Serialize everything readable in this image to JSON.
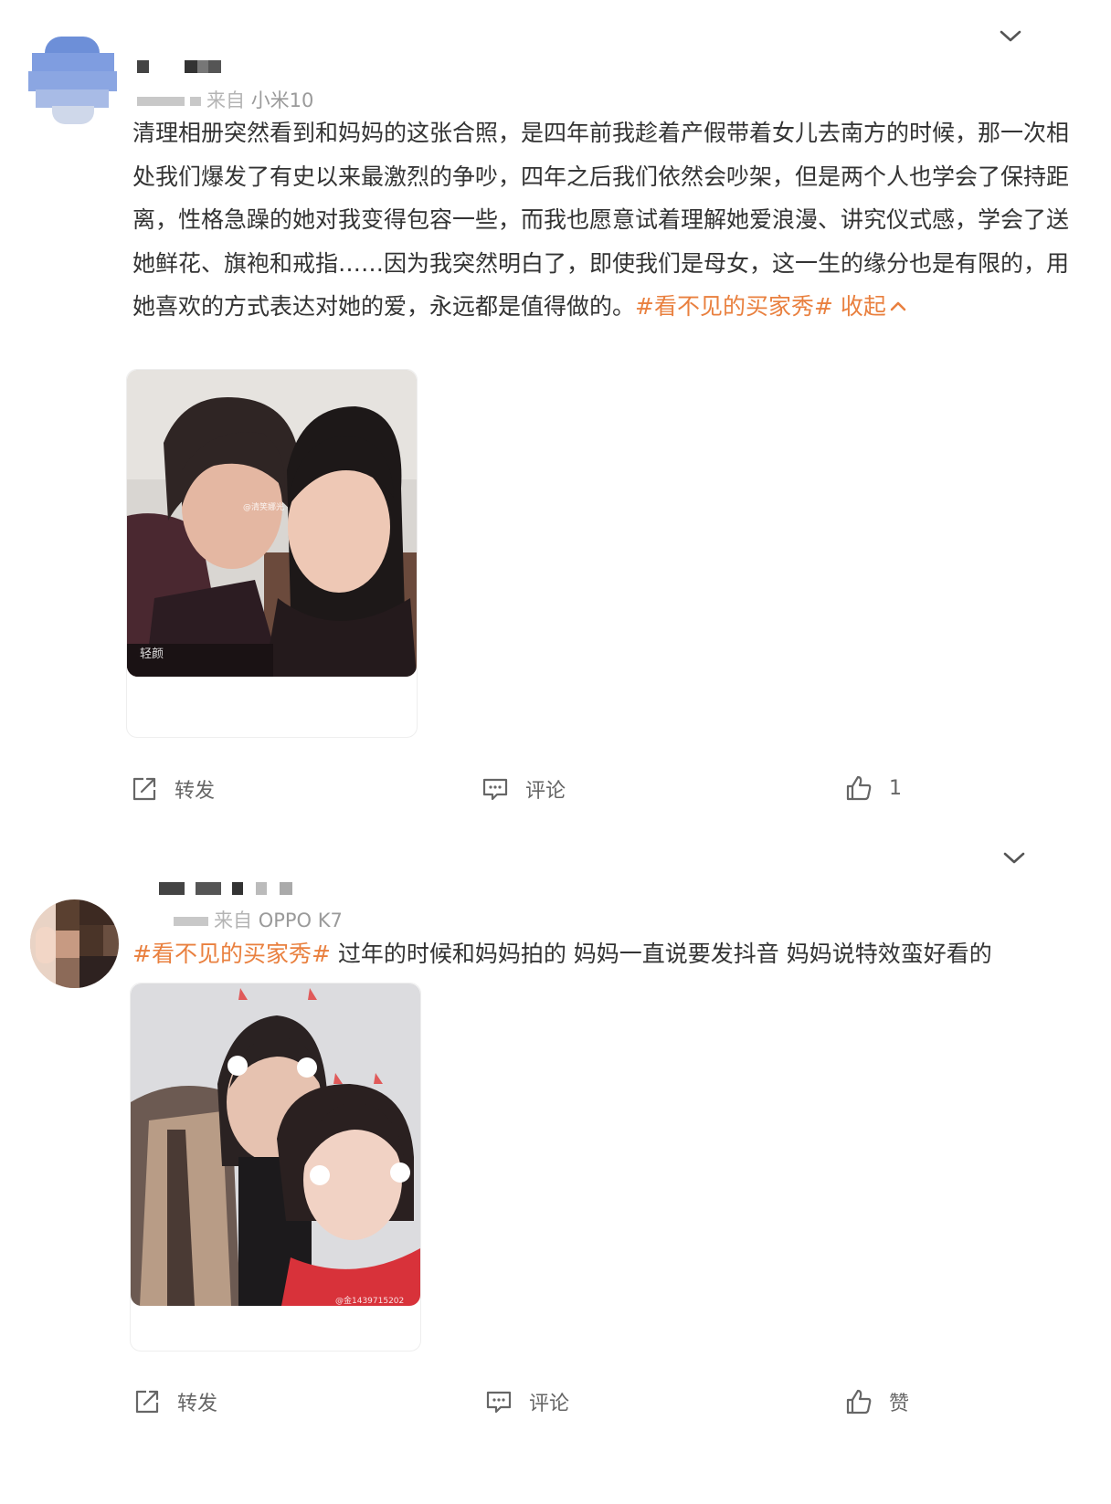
{
  "posts": [
    {
      "source_label": "来自",
      "device": "小米10",
      "text_before": "清理相册突然看到和妈妈的这张合照，是四年前我趁着产假带着女儿去南方的时候，那一次相处我们爆发了有史以来最激烈的争吵，四年之后我们依然会吵架，但是两个人也学会了保持距离，性格急躁的她对我变得包容一些，而我也愿意试着理解她爱浪漫、讲究仪式感，学会了送她鲜花、旗袍和戒指……因为我突然明白了，即使我们是母女，这一生的缘分也是有限的，用她喜欢的方式表达对她的爱，永远都是值得做的。",
      "hashtag": "#看不见的买家秀#",
      "collapse_label": "收起",
      "photo_watermark": "@清笑娜光",
      "photo_corner_text": "轻颜",
      "repost_label": "转发",
      "comment_label": "评论",
      "like_label": "1"
    },
    {
      "source_label": "来自",
      "device": "OPPO K7",
      "hashtag": "#看不见的买家秀#",
      "text_after": " 过年的时候和妈妈拍的 妈妈一直说要发抖音 妈妈说特效蛮好看的",
      "photo_watermark": "@金1439715202",
      "repost_label": "转发",
      "comment_label": "评论",
      "like_label": "赞"
    }
  ],
  "colors": {
    "accent": "#e9803f",
    "text": "#333333",
    "meta": "#9a9a9a",
    "icon": "#666666"
  },
  "icons": {
    "chevron": "chevron-down-icon",
    "repost": "share-icon",
    "comment": "comment-icon",
    "like": "thumbs-up-icon",
    "collapse": "chevron-up-icon"
  }
}
